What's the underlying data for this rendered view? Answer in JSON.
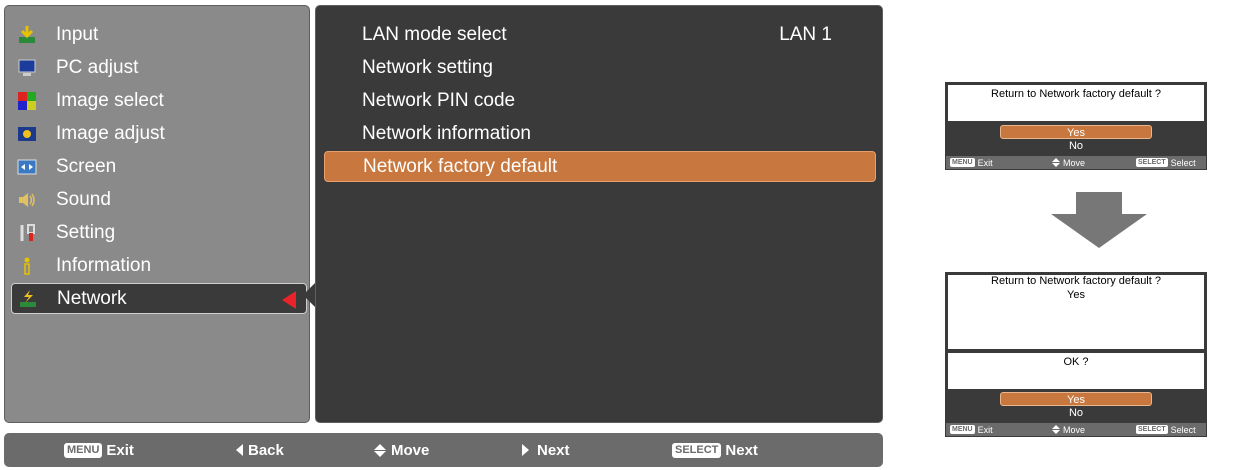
{
  "menu": {
    "items": [
      {
        "label": "Input",
        "icon": "input-icon"
      },
      {
        "label": "PC adjust",
        "icon": "monitor-icon"
      },
      {
        "label": "Image select",
        "icon": "image-select-icon"
      },
      {
        "label": "Image adjust",
        "icon": "image-adjust-icon"
      },
      {
        "label": "Screen",
        "icon": "screen-icon"
      },
      {
        "label": "Sound",
        "icon": "speaker-icon"
      },
      {
        "label": "Setting",
        "icon": "tools-icon"
      },
      {
        "label": "Information",
        "icon": "info-icon"
      },
      {
        "label": "Network",
        "icon": "network-icon",
        "selected": true
      }
    ]
  },
  "submenu": {
    "items": [
      {
        "label": "LAN mode select",
        "value": "LAN 1"
      },
      {
        "label": "Network setting"
      },
      {
        "label": "Network PIN code"
      },
      {
        "label": "Network information"
      },
      {
        "label": "Network factory default",
        "highlighted": true
      }
    ]
  },
  "bottom_bar": {
    "menu_key": "MENU",
    "exit": "Exit",
    "back": "Back",
    "move": "Move",
    "next": "Next",
    "select_key": "SELECT",
    "select_next": "Next"
  },
  "dialog1": {
    "question": "Return to Network factory default ?",
    "yes": "Yes",
    "no": "No",
    "footer": {
      "menu_key": "MENU",
      "exit": "Exit",
      "move": "Move",
      "select_key": "SELECT",
      "select": "Select"
    }
  },
  "dialog2": {
    "question": "Return to Network factory default ?",
    "answer": "Yes",
    "confirm": "OK ?",
    "yes": "Yes",
    "no": "No",
    "footer": {
      "menu_key": "MENU",
      "exit": "Exit",
      "move": "Move",
      "select_key": "SELECT",
      "select": "Select"
    }
  },
  "colors": {
    "highlight": "#c8773e",
    "panel_dark": "#3a3a3a",
    "panel_gray": "#8a8a8a",
    "selection_arrow": "#e8232a"
  }
}
